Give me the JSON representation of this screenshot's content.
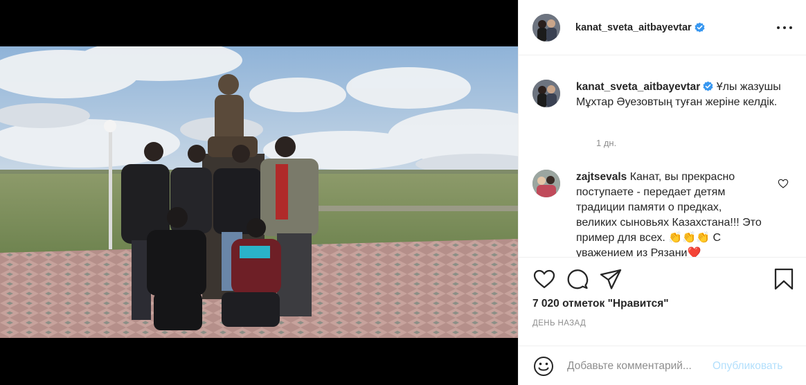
{
  "post": {
    "author": "kanat_sveta_aitbayevtar",
    "photo_alt": "",
    "colors": {
      "accent": "#0095f6",
      "verified": "#3897f0",
      "muted": "#8e8e8e",
      "publish_disabled": "#b2dffc"
    }
  },
  "header": {
    "username": "kanat_sveta_aitbayevtar",
    "more_icon": "more-horizontal-icon"
  },
  "caption": {
    "username": "kanat_sveta_aitbayevtar",
    "text": "Ұлы жазушы Мұхтар Әуезовтың туған жеріне келдік.",
    "time": "1 дн."
  },
  "comments": [
    {
      "username": "zajtsevals",
      "text": "Канат, вы прекрасно поступаете - передает детям традиции памяти о предках, великих сыновьях Казахстана!!! Это пример для всех. 👏👏👏 С уважением из Рязани❤️"
    }
  ],
  "actions": {
    "icons": [
      "heart-icon",
      "comment-icon",
      "share-icon",
      "bookmark-icon"
    ],
    "likes": "7 020 отметок \"Нравится\"",
    "ago": "ДЕНЬ НАЗАД"
  },
  "add_comment": {
    "placeholder": "Добавьте комментарий...",
    "publish": "Опубликовать"
  }
}
